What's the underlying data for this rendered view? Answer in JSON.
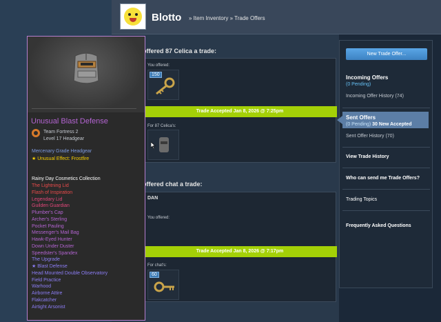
{
  "header": {
    "persona": "Blotto",
    "breadcrumb_1": "» Item Inventory",
    "breadcrumb_2": "» Trade Offers"
  },
  "trades": [
    {
      "title": "offered 87 Celica a trade:",
      "you_offered": "You offered:",
      "offered_qty": "150",
      "banner": "Trade Accepted Jan 8, 2026 @ 7:25pm",
      "for_label": "For 87 Celica's:"
    },
    {
      "title": "offered chat a trade:",
      "message": "DAN",
      "you_offered": "You offered:",
      "banner": "Trade Accepted Jan 8, 2026 @ 7:17pm",
      "for_label": "For chat's:",
      "for_qty": "60"
    }
  ],
  "sidebar": {
    "new_offer": "New Trade Offer...",
    "incoming_title": "Incoming Offers",
    "incoming_pending": "(0 Pending)",
    "incoming_history": "Incoming Offer History (74)",
    "sent_title": "Sent Offers",
    "sent_pending": "(0 Pending)",
    "sent_new": "30 New Accepted",
    "sent_history": "Sent Offer History (70)",
    "view_history": "View Trade History",
    "who_can_send": "Who can send me Trade Offers?",
    "trading_topics": "Trading Topics",
    "faq": "Frequently Asked Questions"
  },
  "tooltip": {
    "name": "Unusual Blast Defense",
    "game": "Team Fortress 2",
    "level": "Level 17 Headgear",
    "grade": "Mercenary Grade Headgear",
    "effect": "★ Unusual Effect: Frostfire",
    "collection": "Rainy Day Cosmetics Collection",
    "items": [
      {
        "name": "The Lightning Lid",
        "color": "#eb4b4b"
      },
      {
        "name": "Flash of Inspiration",
        "color": "#eb4b4b"
      },
      {
        "name": "Legendary Lid",
        "color": "#e4477a"
      },
      {
        "name": "Guilden Guardian",
        "color": "#e4477a"
      },
      {
        "name": "Plumber's Cap",
        "color": "#b464d2"
      },
      {
        "name": "Archer's Sterling",
        "color": "#b464d2"
      },
      {
        "name": "Pocket Pauling",
        "color": "#b464d2"
      },
      {
        "name": "Messenger's Mail Bag",
        "color": "#b464d2"
      },
      {
        "name": "Hawk-Eyed Hunter",
        "color": "#b464d2"
      },
      {
        "name": "Down Under Duster",
        "color": "#b464d2"
      },
      {
        "name": "Speedster's Spandex",
        "color": "#b464d2"
      },
      {
        "name": "The Upgrade",
        "color": "#8c7df5"
      },
      {
        "name": "★ Blast Defense",
        "color": "#8c7df5"
      },
      {
        "name": "Head Mounted Double Observatory",
        "color": "#8c7df5"
      },
      {
        "name": "Field Practice",
        "color": "#8c7df5"
      },
      {
        "name": "Warhood",
        "color": "#8c7df5"
      },
      {
        "name": "Airborne Attire",
        "color": "#8c7df5"
      },
      {
        "name": "Flakcatcher",
        "color": "#8c7df5"
      },
      {
        "name": "Airtight Arsonist",
        "color": "#8c7df5"
      }
    ]
  }
}
